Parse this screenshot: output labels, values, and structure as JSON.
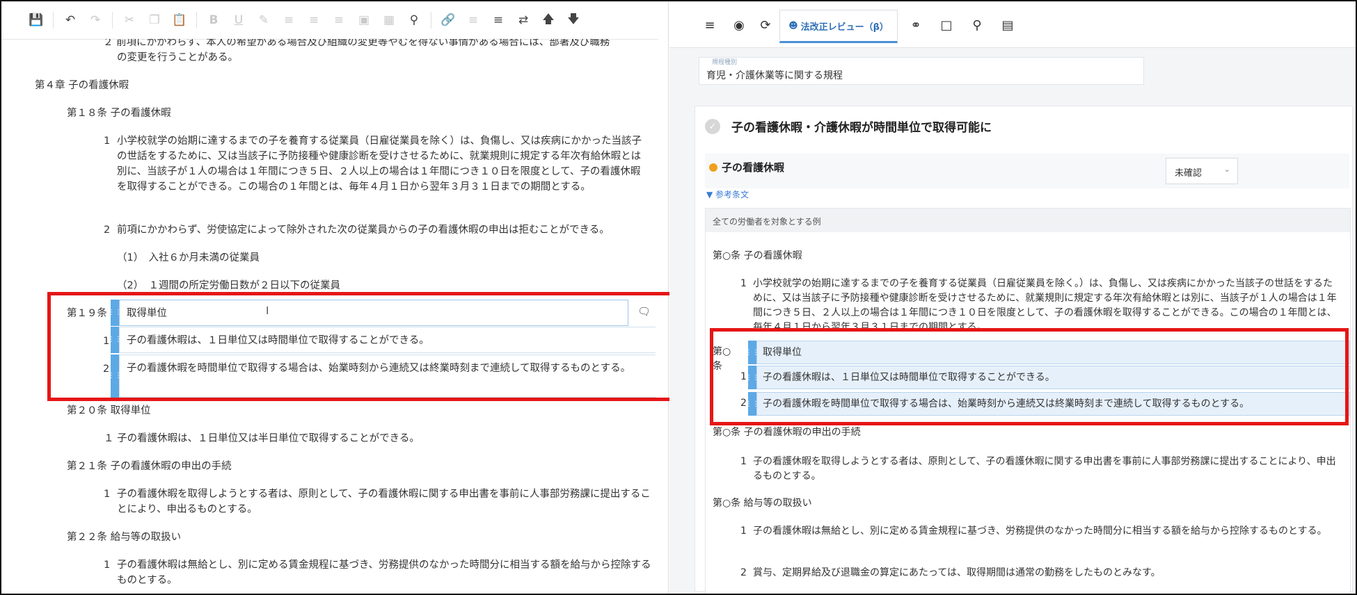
{
  "editor": {
    "doc": {
      "top_cut": "２ 前項にかかわらず、本人の希望がある場合及び組織の変更等やむを得ない事情がある場合には、部署及び職務",
      "top_cut2": "の変更を行うことがある。",
      "chapter": "第４章 子の看護休暇",
      "art18_title": "第１８条 子の看護休暇",
      "art18_p1_num": "1",
      "art18_p1": "小学校就学の始期に達するまでの子を養育する従業員（日雇従業員を除く）は、負傷し、又は疾病にかかった当該子の世話をするために、又は当該子に予防接種や健康診断を受けさせるために、就業規則に規定する年次有給休暇とは別に、当該子が１人の場合は１年間につき５日、２人以上の場合は１年間につき１０日を限度として、子の看護休暇を取得することができる。この場合の１年間とは、毎年４月１日から翌年３月３１日までの期間とする。",
      "art18_p2_num": "2",
      "art18_p2": "前項にかかわらず、労使協定によって除外された次の従業員からの子の看護休暇の申出は拒むことができる。",
      "art18_i1": "（1）　入社６か月未満の従業員",
      "art18_i2": "（2）　１週間の所定労働日数が２日以下の従業員",
      "art19_label": "第１９条",
      "art19_title": "取得単位",
      "art19_p1_num": "1",
      "art19_p1": "子の看護休暇は、１日単位又は時間単位で取得することができる。",
      "art19_p2_num": "2",
      "art19_p2": "子の看護休暇を時間単位で取得する場合は、始業時刻から連続又は終業時刻まで連続して取得するものとする。",
      "art20_title": "第２０条 取得単位",
      "art20_p1": "１ 子の看護休暇は、１日単位又は半日単位で取得することができる。",
      "art21_title": "第２１条 子の看護休暇の申出の手続",
      "art21_p1_num": "1",
      "art21_p1": "子の看護休暇を取得しようとする者は、原則として、子の看護休暇に関する申出書を事前に人事部労務課に提出することにより、申出るものとする。",
      "art22_title": "第２２条 給与等の取扱い",
      "art22_p1_num": "1",
      "art22_p1": "子の看護休暇は無給とし、別に定める賃金規程に基づき、労務提供のなかった時間分に相当する額を給与から控除するものとする。"
    },
    "toolbar_icons": [
      "save-icon",
      "undo-icon",
      "redo-icon",
      "cut-icon",
      "copy-icon",
      "paste-icon",
      "bold-icon",
      "underline-icon",
      "highlight-icon",
      "align-left-icon",
      "align-center-icon",
      "align-right-icon",
      "image-icon",
      "table-icon",
      "find-icon",
      "link-icon",
      "insert-icon",
      "clear-format-icon",
      "swap-icon",
      "move-up-icon",
      "move-down-icon"
    ]
  },
  "review": {
    "tab_label": "法改正レビュー（β）",
    "field_label": "規程種別",
    "field_value": "育児・介護休業等に関する規程",
    "card_title": "子の看護休暇・介護休暇が時間単位で取得可能に",
    "sub_title": "子の看護休暇",
    "status": "未確認",
    "ref_link": "▼ 参考条文",
    "example_head": "全ての労働者を対象とする例",
    "ex": {
      "a1_title": "第○条 子の看護休暇",
      "a1_p1_num": "1",
      "a1_p1": "小学校就学の始期に達するまでの子を養育する従業員（日雇従業員を除く。）は、負傷し、又は疾病にかかった当該子の世話をするために、又は当該子に予防接種や健康診断を受けさせるために、就業規則に規定する年次有給休暇とは別に、当該子が１人の場合は１年間につき５日、２人以上の場合は１年間につき１０日を限度として、子の看護休暇を取得することができる。この場合の１年間とは、毎年４月１日から翌年３月３１日までの期間とする。",
      "a2_label": "第○条",
      "a2_title": "取得単位",
      "a2_p1_num": "1",
      "a2_p1": "子の看護休暇は、１日単位又は時間単位で取得することができる。",
      "a2_p2_num": "2",
      "a2_p2": "子の看護休暇を時間単位で取得する場合は、始業時刻から連続又は終業時刻まで連続して取得するものとする。",
      "a3_title": "第○条 子の看護休暇の申出の手続",
      "a3_p1_num": "1",
      "a3_p1": "子の看護休暇を取得しようとする者は、原則として、子の看護休暇に関する申出書を事前に人事部労務課に提出することにより、申出るものとする。",
      "a4_title": "第○条 給与等の取扱い",
      "a4_p1_num": "1",
      "a4_p1": "子の看護休暇は無給とし、別に定める賃金規程に基づき、労務提供のなかった時間分に相当する額を給与から控除するものとする。",
      "a4_p2_num": "2",
      "a4_p2": "賞与、定期昇給及び退職金の算定にあたっては、取得期間は通常の勤務をしたものとみなす。"
    }
  }
}
